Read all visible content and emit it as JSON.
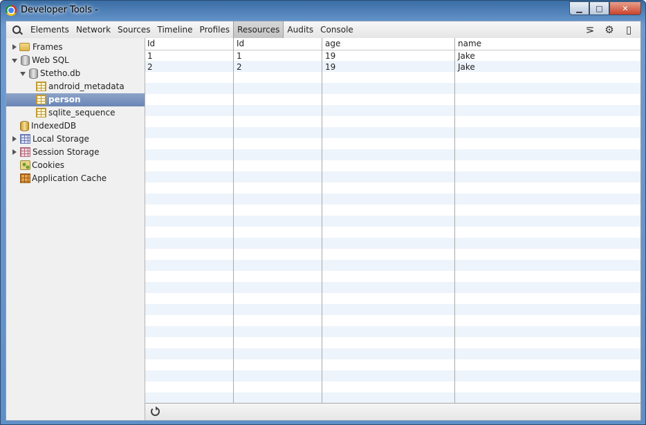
{
  "window": {
    "title": "Developer Tools -"
  },
  "toolbar": {
    "tabs": [
      "Elements",
      "Network",
      "Sources",
      "Timeline",
      "Profiles",
      "Resources",
      "Audits",
      "Console"
    ],
    "active_tab": "Resources"
  },
  "sidebar": {
    "items": [
      {
        "label": "Frames",
        "icon": "folder-icon",
        "expanded": false
      },
      {
        "label": "Web SQL",
        "icon": "database-icon",
        "expanded": true
      },
      {
        "label": "Stetho.db",
        "icon": "database-icon",
        "expanded": true
      },
      {
        "label": "android_metadata",
        "icon": "table-icon"
      },
      {
        "label": "person",
        "icon": "table-icon",
        "selected": true
      },
      {
        "label": "sqlite_sequence",
        "icon": "table-icon"
      },
      {
        "label": "IndexedDB",
        "icon": "database-icon"
      },
      {
        "label": "Local Storage",
        "icon": "grid-icon",
        "expanded": false
      },
      {
        "label": "Session Storage",
        "icon": "grid-icon",
        "expanded": false
      },
      {
        "label": "Cookies",
        "icon": "cookie-icon"
      },
      {
        "label": "Application Cache",
        "icon": "application-cache-icon"
      }
    ]
  },
  "table": {
    "columns": [
      "Id",
      "Id",
      "age",
      "name"
    ],
    "rows": [
      [
        "1",
        "1",
        "19",
        "Jake"
      ],
      [
        "2",
        "2",
        "19",
        "Jake"
      ]
    ]
  }
}
